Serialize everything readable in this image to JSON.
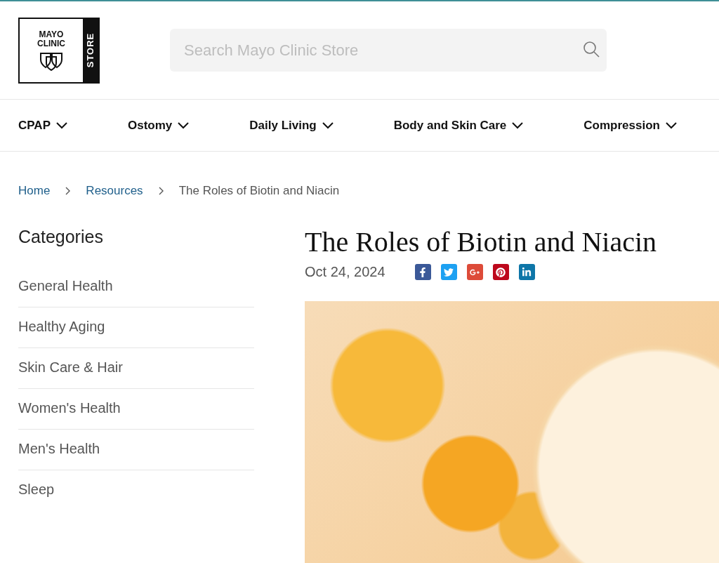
{
  "logo": {
    "title": "MAYO CLINIC",
    "badge": "STORE"
  },
  "search": {
    "placeholder": "Search Mayo Clinic Store"
  },
  "nav": [
    {
      "label": "CPAP"
    },
    {
      "label": "Ostomy"
    },
    {
      "label": "Daily Living"
    },
    {
      "label": "Body and Skin Care"
    },
    {
      "label": "Compression"
    }
  ],
  "breadcrumb": [
    {
      "label": "Home",
      "kind": "link"
    },
    {
      "label": "Resources",
      "kind": "link"
    },
    {
      "label": "The Roles of Biotin and Niacin",
      "kind": "current"
    }
  ],
  "sidebar": {
    "title": "Categories",
    "items": [
      {
        "label": "General Health"
      },
      {
        "label": "Healthy Aging"
      },
      {
        "label": "Skin Care & Hair"
      },
      {
        "label": "Women's Health"
      },
      {
        "label": "Men's Health"
      },
      {
        "label": "Sleep"
      }
    ]
  },
  "article": {
    "title": "The Roles of Biotin and Niacin",
    "date": "Oct 24, 2024",
    "share": [
      {
        "kind": "facebook",
        "color": "#3b5998"
      },
      {
        "kind": "twitter",
        "color": "#1da1f2"
      },
      {
        "kind": "googleplus",
        "color": "#dd4b39"
      },
      {
        "kind": "pinterest",
        "color": "#bd081c"
      },
      {
        "kind": "linkedin",
        "color": "#0e76a8"
      }
    ]
  }
}
